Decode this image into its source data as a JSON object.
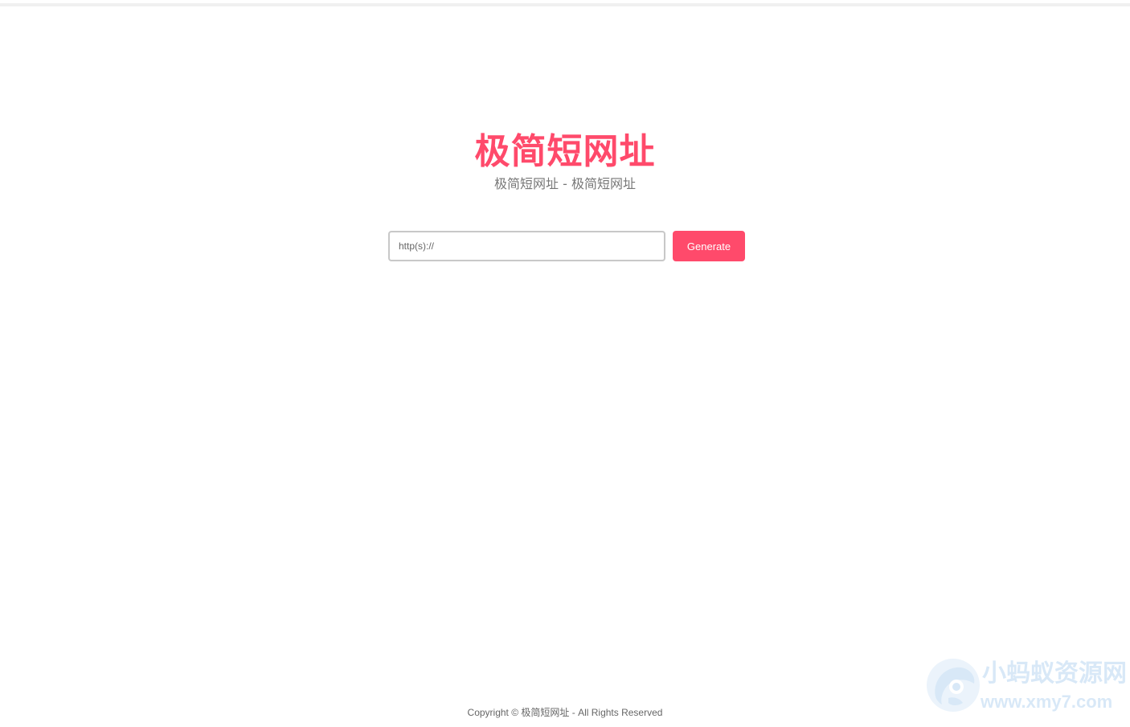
{
  "header": {
    "title": "极简短网址",
    "subtitle": "极简短网址 - 极简短网址"
  },
  "form": {
    "url_placeholder": "http(s)://",
    "generate_label": "Generate"
  },
  "footer": {
    "copyright": "Copyright © 极简短网址 - All Rights Reserved"
  },
  "watermark": {
    "name": "小蚂蚁资源网",
    "url": "www.xmy7.com",
    "icon": "ant-logo-icon"
  },
  "colors": {
    "accent": "#ff4a6b",
    "subtitle": "#777777",
    "footer_text": "#666666",
    "watermark": "#b9d7f2"
  }
}
